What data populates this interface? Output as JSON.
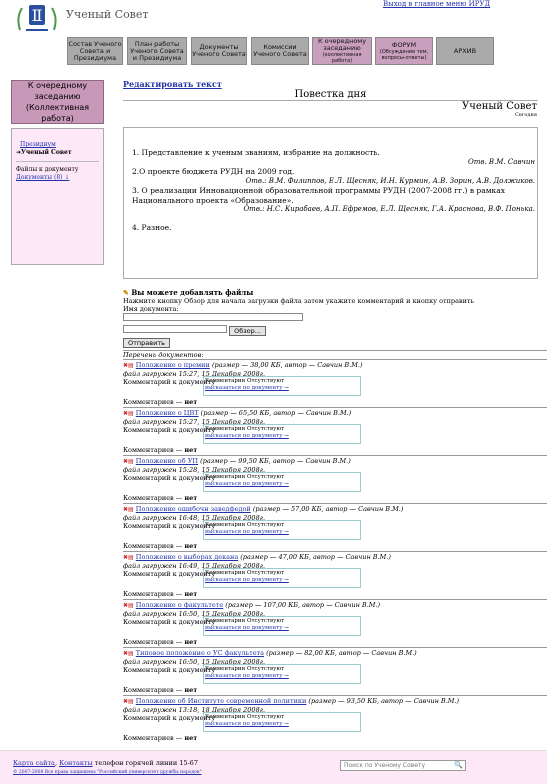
{
  "header": {
    "site_title": "Ученый Совет",
    "main_menu_link": "Выход в главное меню ИРУД"
  },
  "nav": [
    {
      "label": "Состав Ученого Совета и Президиума",
      "sub": ""
    },
    {
      "label": "План работы Ученого Совета и Президиума",
      "sub": ""
    },
    {
      "label": "Документы Ученого Совета",
      "sub": ""
    },
    {
      "label": "Комиссии Ученого Совета",
      "sub": ""
    },
    {
      "label": "К очередному заседанию",
      "sub": "(коллективная работа)"
    },
    {
      "label": "ФОРУМ",
      "sub": "(Обсуждение тем, вопросы-ответы)"
    },
    {
      "label": "АРХИВ",
      "sub": ""
    }
  ],
  "left": {
    "box_title": "К очередному заседанию (Коллективная работа)",
    "items": [
      "Президиум",
      "Ученый Совет"
    ],
    "files_label": "Файлы к документу",
    "docs_link": "Документы (8) ↓"
  },
  "main": {
    "edit_link": "Редактировать текст",
    "agenda_title": "Повестка дня",
    "council": "Ученый Совет",
    "today": "Сегодня",
    "agenda": [
      {
        "text": "1. Представление к ученым званиям, избрание на должность.",
        "resp": "Отв. В.М. Савчин"
      },
      {
        "text": "2.О проекте бюджета РУДН на 2009 год.",
        "resp": "Отв.: В.М. Филиппов, Е.Л. Щесняк, И.Н. Курмин, А.В. Зорин, А.В. Должиков."
      },
      {
        "text": "3. О реализации Инновационной образовательной программы РУДН (2007-2008 гг.) в рамках Национального проекта «Образование».",
        "resp": "Отв.: Н.С. Кирабаев, А.П. Ефремов, Е.Л. Щесняк, Г.А. Краснова, В.Ф. Понька."
      },
      {
        "text": "4. Разное.",
        "resp": ""
      }
    ]
  },
  "upload": {
    "header": "Вы можете добавлять файлы",
    "instructions": "Нажмите кнопку Обзор для начала загрузки файла затем укажите комментарий и кнопку отправить",
    "doc_name_label": "Имя документа:",
    "browse_label": "Обзор...",
    "send_label": "Отправить",
    "list_label": "Перечень документов:"
  },
  "docs": [
    {
      "name": "Положение о премии",
      "meta": "(размер — 38,00 КБ, автор — Савчин В.М.)",
      "uploaded": "файл загружен 15:27, 15 Декабря 2008г."
    },
    {
      "name": "Положение о ЦВТ",
      "meta": "(размер — 65,50 КБ, автор — Савчин В.М.)",
      "uploaded": "файл загружен 15:27, 15 Декабря 2008г."
    },
    {
      "name": "Положение об УП",
      "meta": "(размер — 99,50 КБ, автор — Савчин В.М.)",
      "uploaded": "файл загружен 15:28, 15 Декабря 2008г."
    },
    {
      "name": "Положение ошибочн заведфедой",
      "meta": "(размер — 57,00 КБ, автор — Савчин В.М.)",
      "uploaded": "файл загружен 16:48, 15 Декабря 2008г."
    },
    {
      "name": "Положение о выборах декана",
      "meta": "(размер — 47,00 КБ, автор — Савчин В.М.)",
      "uploaded": "файл загружен 16:49, 15 Декабря 2008г."
    },
    {
      "name": "Положение о факультете",
      "meta": "(размер — 107,00 КБ, автор — Савчин В.М.)",
      "uploaded": "файл загружен 16:50, 15 Декабря 2008г."
    },
    {
      "name": "Типовое положение о УС факультета",
      "meta": "(размер — 82,00 КБ, автор — Савчин В.М.)",
      "uploaded": "файл загружен 16:50, 15 Декабря 2008г."
    },
    {
      "name": "Положение об Институте современной политики",
      "meta": "(размер — 93,50 КБ, автор — Савчин В.М.)",
      "uploaded": "файл загружен 13:18, 18 Декабря 2008г."
    }
  ],
  "doc_common": {
    "comment_label": "Комментарий к документу",
    "comments_absent": "Комментарии Отсутствуют",
    "speak_link": "высказаться по документу →",
    "count_label": "Комментариев —",
    "count_value": "нет"
  },
  "footer": {
    "sitemap": "Карта сайта",
    "contacts": "Контакты",
    "hotline": "телефон горячей линии 15-67",
    "copyright": "© 2007-2008 Все права защищены \"Российский университет дружбы народов\"",
    "search_placeholder": "Поиск по Ученому Совету"
  }
}
